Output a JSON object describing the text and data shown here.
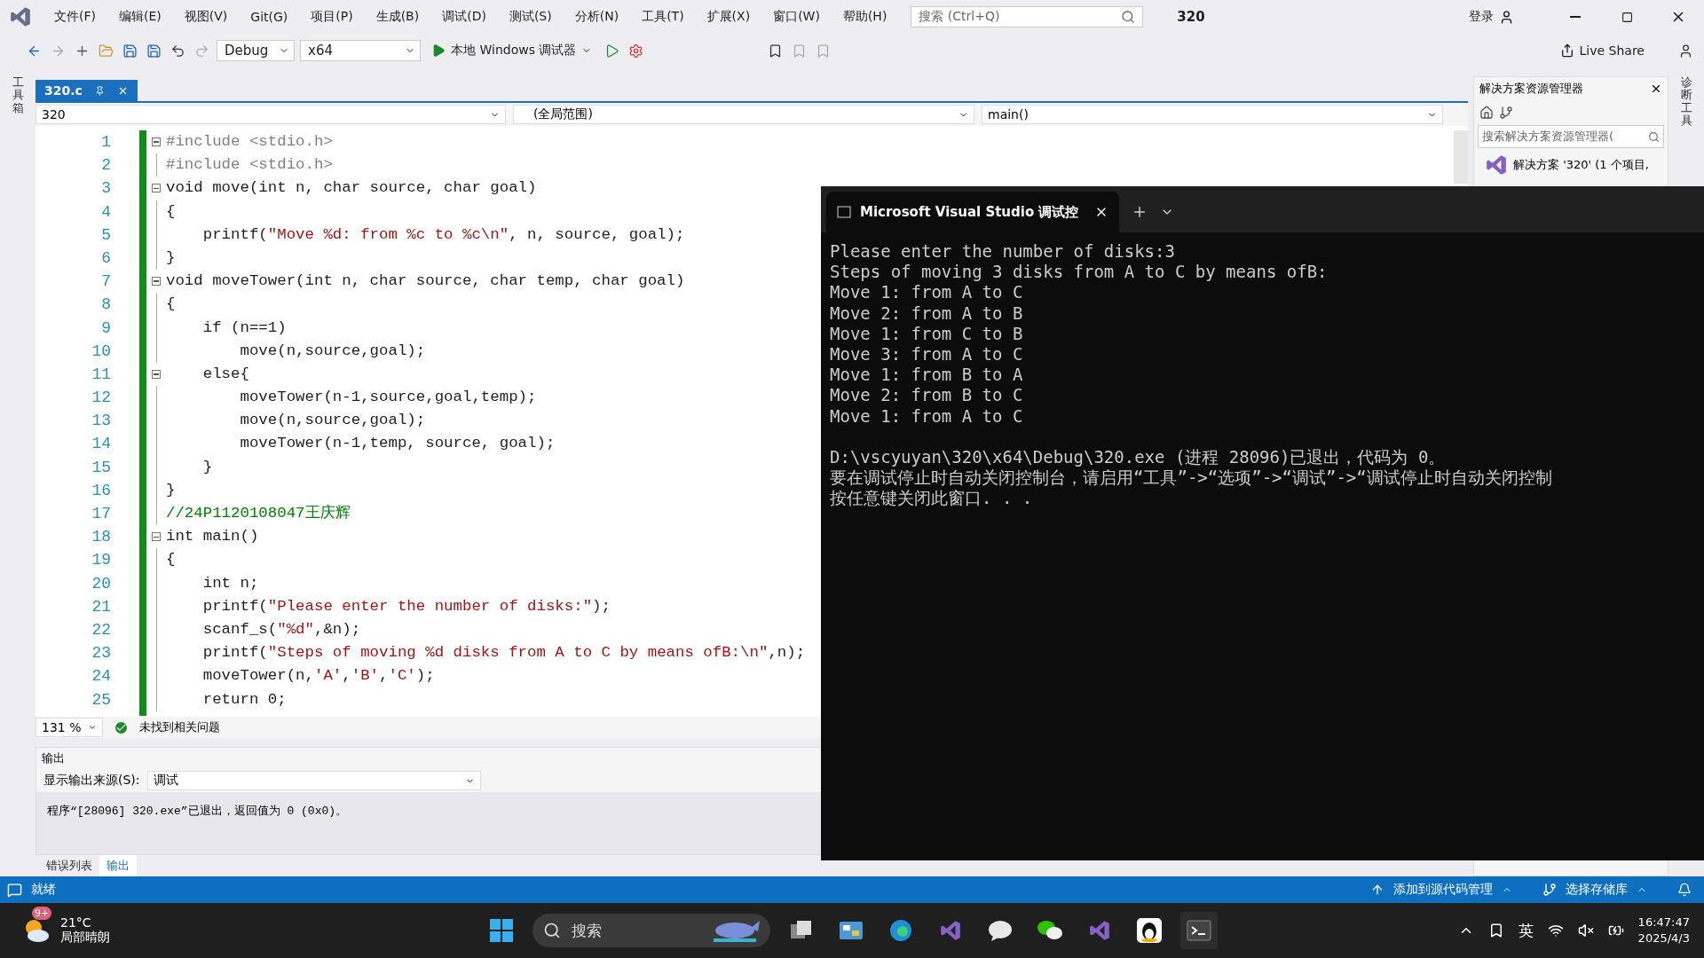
{
  "menu_bar": {
    "items": [
      "文件(F)",
      "编辑(E)",
      "视图(V)",
      "Git(G)",
      "项目(P)",
      "生成(B)",
      "调试(D)",
      "测试(S)",
      "分析(N)",
      "工具(T)",
      "扩展(X)",
      "窗口(W)",
      "帮助(H)"
    ],
    "search": {
      "placeholder": "搜索 (Ctrl+Q)"
    },
    "solution_title": "320",
    "sign_in": "登录"
  },
  "toolbar": {
    "configuration": "Debug",
    "platform": "x64",
    "run_target": "本地 Windows 调试器",
    "live_share": "Live Share"
  },
  "left_strip": "工具箱",
  "right_strip": "诊断工具",
  "document_tabs": [
    {
      "label": "320.c",
      "selected": true
    }
  ],
  "nav_bar": {
    "project": "320",
    "scope": "(全局范围)",
    "member": "main()"
  },
  "code_lines": [
    {
      "number": "1",
      "text": "#include <stdio.h>",
      "kind": "preprocessor",
      "foldable": true
    },
    {
      "number": "2",
      "text": "#include <stdio.h>",
      "kind": "preprocessor",
      "foldable": false
    },
    {
      "number": "3",
      "text": "void move(int n, char source, char goal)",
      "kind": "code",
      "foldable": true
    },
    {
      "number": "4",
      "text": "{",
      "kind": "code",
      "foldable": false
    },
    {
      "number": "5",
      "text": "    printf(\"Move %d: from %c to %c\\n\", n, source, goal);",
      "kind": "code",
      "foldable": false
    },
    {
      "number": "6",
      "text": "}",
      "kind": "code",
      "foldable": false
    },
    {
      "number": "7",
      "text": "void moveTower(int n, char source, char temp, char goal)",
      "kind": "code",
      "foldable": true
    },
    {
      "number": "8",
      "text": "{",
      "kind": "code",
      "foldable": false
    },
    {
      "number": "9",
      "text": "    if (n==1)",
      "kind": "code",
      "foldable": false
    },
    {
      "number": "10",
      "text": "        move(n,source,goal);",
      "kind": "code",
      "foldable": false
    },
    {
      "number": "11",
      "text": "    else{",
      "kind": "code",
      "foldable": true
    },
    {
      "number": "12",
      "text": "        moveTower(n-1,source,goal,temp);",
      "kind": "code",
      "foldable": false
    },
    {
      "number": "13",
      "text": "        move(n,source,goal);",
      "kind": "code",
      "foldable": false
    },
    {
      "number": "14",
      "text": "        moveTower(n-1,temp, source, goal);",
      "kind": "code",
      "foldable": false
    },
    {
      "number": "15",
      "text": "    }",
      "kind": "code",
      "foldable": false
    },
    {
      "number": "16",
      "text": "}",
      "kind": "code",
      "foldable": false
    },
    {
      "number": "17",
      "text": "//24P1120108047王庆辉",
      "kind": "comment",
      "foldable": false
    },
    {
      "number": "18",
      "text": "int main()",
      "kind": "code",
      "foldable": true
    },
    {
      "number": "19",
      "text": "{",
      "kind": "code",
      "foldable": false
    },
    {
      "number": "20",
      "text": "    int n;",
      "kind": "code",
      "foldable": false
    },
    {
      "number": "21",
      "text": "    printf(\"Please enter the number of disks:\");",
      "kind": "code",
      "foldable": false
    },
    {
      "number": "22",
      "text": "    scanf_s(\"%d\",&n);",
      "kind": "code",
      "foldable": false
    },
    {
      "number": "23",
      "text": "    printf(\"Steps of moving %d disks from A to C by means ofB:\\n\",n);",
      "kind": "code",
      "foldable": false
    },
    {
      "number": "24",
      "text": "    moveTower(n,'A','B','C');",
      "kind": "code",
      "foldable": false
    },
    {
      "number": "25",
      "text": "    return 0;",
      "kind": "code",
      "foldable": false
    }
  ],
  "editor_status": {
    "zoom": "131 %",
    "issues": "未找到相关问题"
  },
  "output": {
    "title": "输出",
    "source_label": "显示输出来源(S):",
    "source": "调试",
    "lines": [
      "程序“[28096] 320.exe”已退出，返回值为 0 (0x0)。"
    ]
  },
  "bottom_tabs": [
    {
      "label": "错误列表",
      "selected": false
    },
    {
      "label": "输出",
      "selected": true
    }
  ],
  "solution_explorer": {
    "title": "解决方案资源管理器",
    "search": {
      "placeholder": "搜索解决方案资源管理器("
    },
    "items": [
      "解决方案 '320' (1 个项目,"
    ]
  },
  "console": {
    "tab_title": "Microsoft Visual Studio 调试控",
    "output_lines": [
      "Please enter the number of disks:3",
      "Steps of moving 3 disks from A to C by means ofB:",
      "Move 1: from A to C",
      "Move 2: from A to B",
      "Move 1: from C to B",
      "Move 3: from A to C",
      "Move 1: from B to A",
      "Move 2: from B to C",
      "Move 1: from A to C"
    ],
    "exit_lines": [
      "D:\\vscyuyan\\320\\x64\\Debug\\320.exe (进程 28096)已退出，代码为 0。",
      "要在调试停止时自动关闭控制台，请启用“工具”->“选项”->“调试”->“调试停止时自动关闭控制",
      "按任意键关闭此窗口. . ."
    ]
  },
  "status_bar": {
    "state": "就绪",
    "source_control": "添加到源代码管理",
    "repository": "选择存储库"
  },
  "taskbar": {
    "weather": {
      "badge": "9+",
      "temperature": "21°C",
      "condition": "局部晴朗"
    },
    "search": {
      "placeholder": "搜索"
    },
    "ime": "英",
    "time": "16:47:47",
    "date": "2025/4/3"
  }
}
